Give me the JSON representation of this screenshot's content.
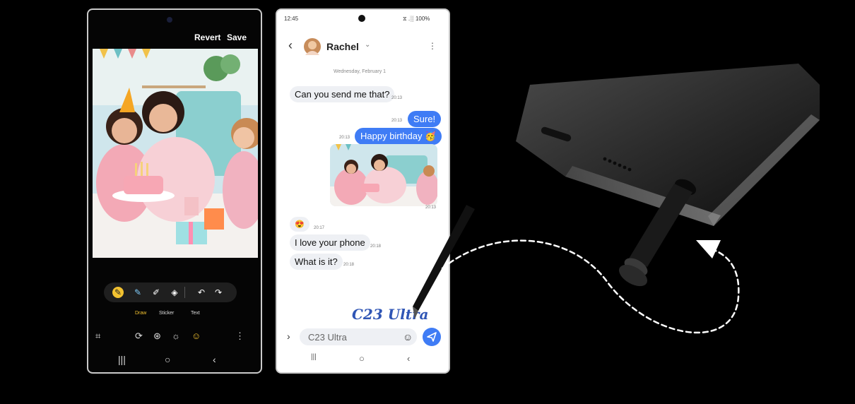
{
  "editor": {
    "revert_label": "Revert",
    "save_label": "Save",
    "modes": [
      "Draw",
      "Sticker",
      "Text"
    ],
    "active_mode": "Draw",
    "tools": [
      "pen-tool",
      "highlighter-tool",
      "pencil-tool",
      "eraser-tool",
      "undo",
      "redo"
    ],
    "bottom_icons": [
      "crop-icon",
      "rotate-icon",
      "filter-icon",
      "brightness-icon",
      "sticker-icon",
      "more-icon"
    ]
  },
  "messages": {
    "status_time": "12:45",
    "status_right": "⧖ .░ 100%",
    "contact_name": "Rachel",
    "date_label": "Wednesday, February 1",
    "items": [
      {
        "dir": "in",
        "text": "Can you send me that?",
        "time": "20:13"
      },
      {
        "dir": "out",
        "text": "Sure!",
        "time": "20:13"
      },
      {
        "dir": "out",
        "text": "Happy birthday 🥳",
        "time": "20:13"
      },
      {
        "dir": "out_image",
        "time": "20:13"
      },
      {
        "dir": "in",
        "text": "😍",
        "time": "20:17"
      },
      {
        "dir": "in",
        "text": "I love your phone",
        "time": "20:18"
      },
      {
        "dir": "in",
        "text": "What is it?",
        "time": "20:18"
      }
    ],
    "handwriting": "C23 Ultra",
    "input_value": "C23 Ultra"
  },
  "colors": {
    "accent": "#3f7cf5",
    "sticker_yellow": "#f2c230"
  }
}
